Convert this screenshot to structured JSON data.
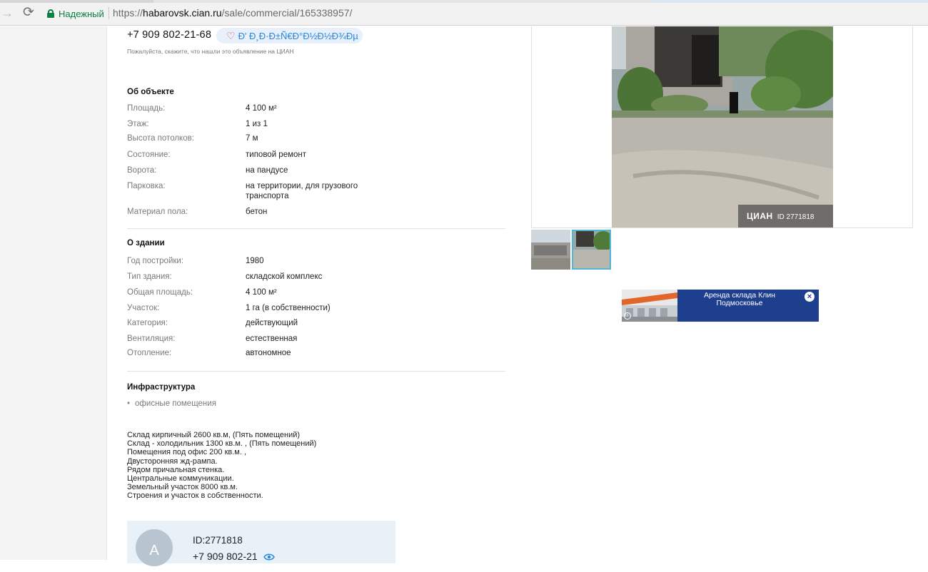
{
  "browser": {
    "security_label": "Надежный",
    "url_scheme": "https://",
    "url_host": "habarovsk.cian.ru",
    "url_path": "/sale/commercial/165338957/"
  },
  "contact": {
    "phone": "+7 909 802-21-68",
    "favorite_label": "Ð' Ð¸Ð·Ð±Ñ€Ð°Ð½Ð½Ð¾Ðµ",
    "hint": "Пожалуйста, скажите, что нашли это объявление на ЦИАН"
  },
  "object": {
    "title": "Об объекте",
    "rows": [
      {
        "key": "Площадь:",
        "value": "4 100 м²"
      },
      {
        "key": "Этаж:",
        "value": "1 из 1"
      },
      {
        "key": "Высота потолков:",
        "value": "7 м"
      },
      {
        "key": "Состояние:",
        "value": "типовой ремонт"
      },
      {
        "key": "Ворота:",
        "value": "на пандусе"
      },
      {
        "key": "Парковка:",
        "value": "на территории, для грузового транспорта"
      },
      {
        "key": "Материал пола:",
        "value": "бетон"
      }
    ]
  },
  "building": {
    "title": "О здании",
    "rows": [
      {
        "key": "Год постройки:",
        "value": "1980"
      },
      {
        "key": "Тип здания:",
        "value": "складской комплекс"
      },
      {
        "key": "Общая площадь:",
        "value": "4 100 м²"
      },
      {
        "key": "Участок:",
        "value": "1 га (в собственности)"
      },
      {
        "key": "Категория:",
        "value": "действующий"
      },
      {
        "key": "Вентиляция:",
        "value": "естественная"
      },
      {
        "key": "Отопление:",
        "value": "автономное"
      }
    ]
  },
  "infrastructure": {
    "title": "Инфраструктура",
    "items": [
      "офисные помещения"
    ]
  },
  "description": [
    "Склад кирпичный 2600 кв.м, (Пять помещений)",
    "Склад - холодильник 1300 кв.м. , (Пять помещений)",
    "Помещения под офис 200 кв.м. ,",
    "Двусторонняя жд-рампа.",
    "Рядом причальная стенка.",
    "Центральные коммуникации.",
    "Земельный участок 8000 кв.м.",
    "Строения и участок в собственности."
  ],
  "agent": {
    "avatar_letter": "А",
    "id_label": "ID:2771818",
    "phone_partial": "+7 909 802-21"
  },
  "photo": {
    "watermark_brand": "ЦИАН",
    "watermark_id": "ID 2771818"
  },
  "ad": {
    "text_line1": "Аренда склада Клин",
    "text_line2": "Подмосковье",
    "close_symbol": "×",
    "info_symbol": "i"
  },
  "icons": [
    "lock-icon",
    "back-arrow-icon",
    "reload-icon",
    "heart-icon",
    "eye-icon",
    "close-icon",
    "info-icon"
  ]
}
